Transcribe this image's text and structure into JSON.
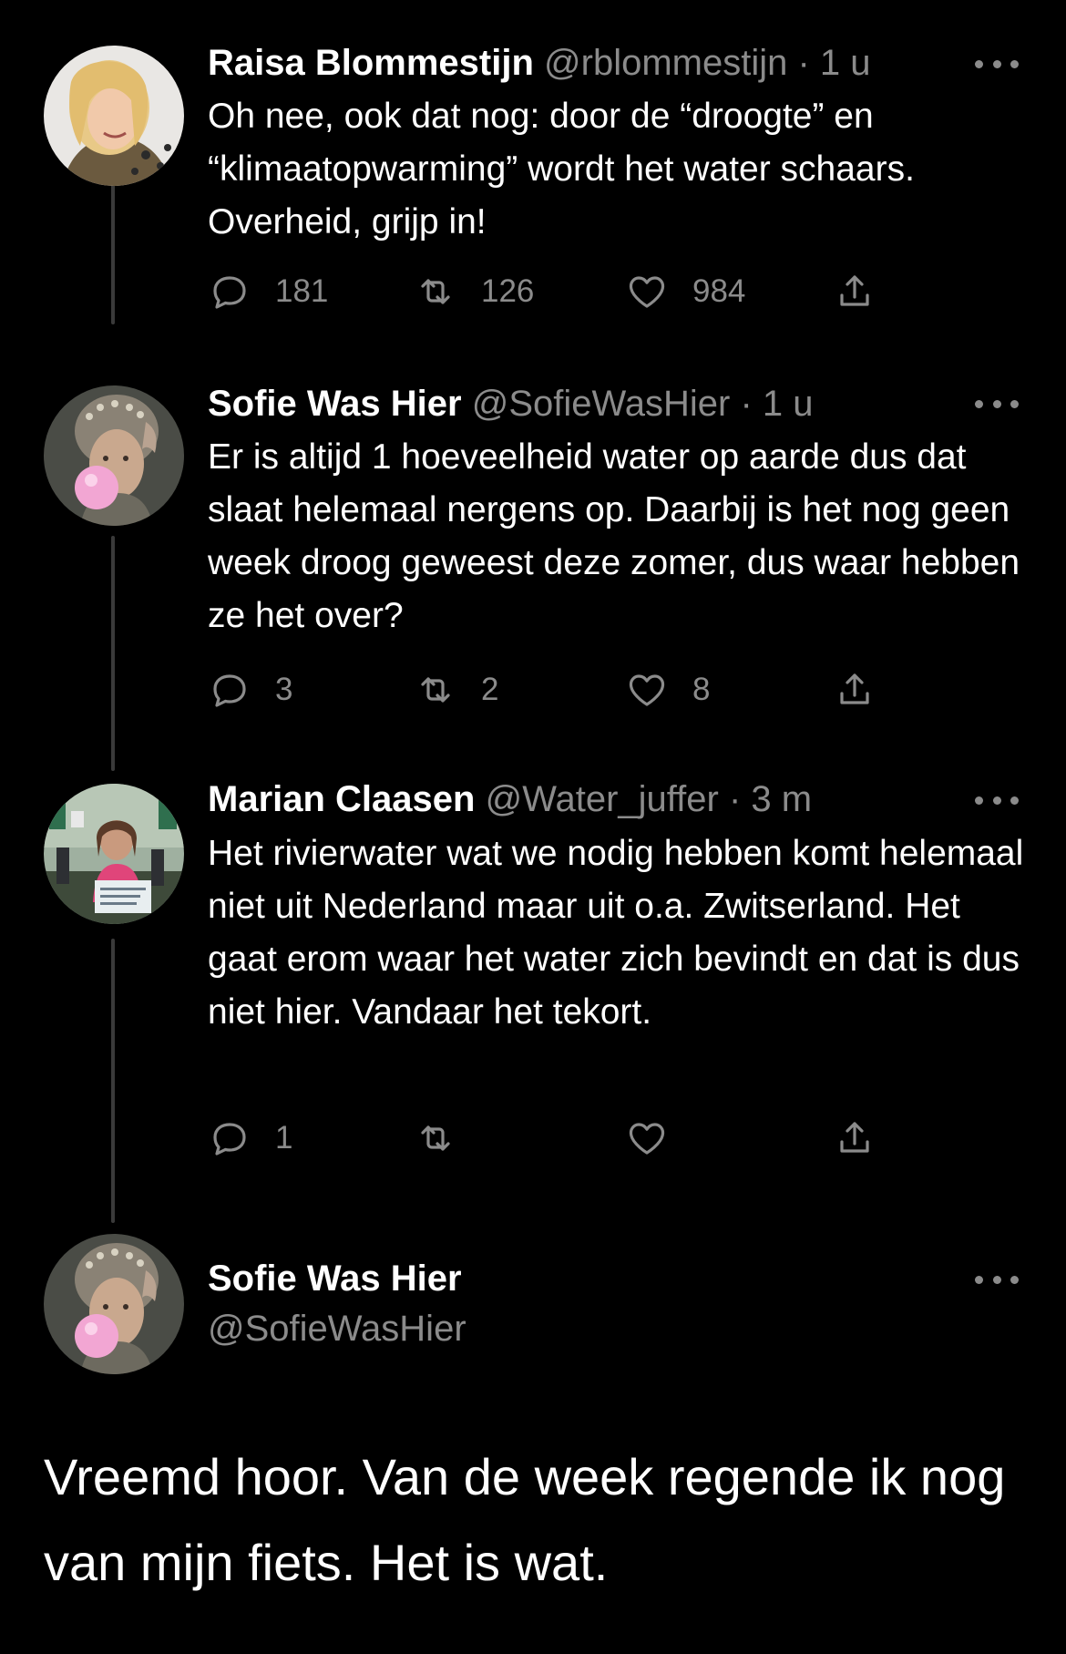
{
  "tweets": [
    {
      "name": "Raisa Blommestijn",
      "handle": "@rblommestijn",
      "time": "· 1 u",
      "text": "Oh nee, ook dat nog: door de “droogte” en “klimaatopwarming” wordt het water schaars. Overheid, grijp in!",
      "replies": "181",
      "retweets": "126",
      "likes": "984"
    },
    {
      "name": "Sofie Was Hier",
      "handle": "@SofieWasHier",
      "time": "· 1 u",
      "text": "Er is altijd 1 hoeveelheid water op aarde dus dat slaat helemaal nergens op. Daarbij is het nog geen week droog geweest deze zomer, dus waar hebben ze het over?",
      "replies": "3",
      "retweets": "2",
      "likes": "8"
    },
    {
      "name": "Marian Claasen",
      "handle": "@Water_juffer",
      "time": "· 3 m",
      "text": "Het rivierwater wat we nodig hebben komt helemaal niet uit Nederland maar uit o.a. Zwitserland.  Het gaat erom waar het water zich bevindt en dat is dus niet hier. Vandaar het tekort.",
      "replies": "1",
      "retweets": "",
      "likes": ""
    }
  ],
  "main_tweet": {
    "name": "Sofie Was Hier",
    "handle": "@SofieWasHier",
    "text": "Vreemd hoor. Van de week regende ik nog van mijn fiets. Het is wat."
  },
  "colors": {
    "background": "#000000",
    "muted": "#8b8b8b",
    "thread_line": "#3a3a3a",
    "bubble_gum": "#f2a6d3"
  },
  "icons": [
    "reply-icon",
    "retweet-icon",
    "like-icon",
    "share-icon",
    "more-icon"
  ]
}
